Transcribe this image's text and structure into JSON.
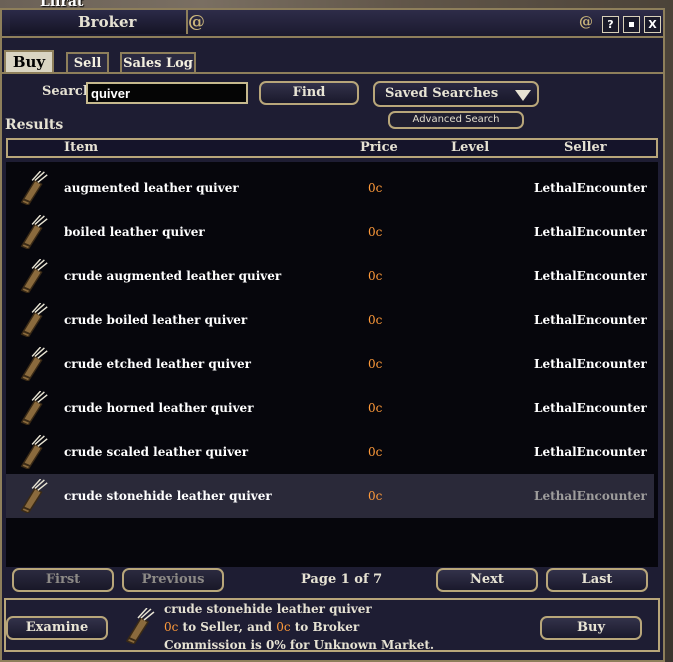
{
  "player_name": "Lilrat",
  "window": {
    "title": "Broker",
    "help": "?",
    "close": "X"
  },
  "tabs": [
    {
      "label": "Buy"
    },
    {
      "label": "Sell"
    },
    {
      "label": "Sales Log"
    }
  ],
  "search": {
    "label": "Search",
    "value": "quiver",
    "find": "Find",
    "saved": "Saved Searches",
    "advanced": "Advanced Search"
  },
  "results_label": "Results",
  "columns": {
    "item": "Item",
    "price": "Price",
    "level": "Level",
    "seller": "Seller"
  },
  "rows": [
    {
      "item": "augmented leather quiver",
      "price": "0c",
      "level": "",
      "seller": "LethalEncounter"
    },
    {
      "item": "boiled leather quiver",
      "price": "0c",
      "level": "",
      "seller": "LethalEncounter"
    },
    {
      "item": "crude augmented leather quiver",
      "price": "0c",
      "level": "",
      "seller": "LethalEncounter"
    },
    {
      "item": "crude boiled leather quiver",
      "price": "0c",
      "level": "",
      "seller": "LethalEncounter"
    },
    {
      "item": "crude etched leather quiver",
      "price": "0c",
      "level": "",
      "seller": "LethalEncounter"
    },
    {
      "item": "crude horned leather quiver",
      "price": "0c",
      "level": "",
      "seller": "LethalEncounter"
    },
    {
      "item": "crude scaled leather quiver",
      "price": "0c",
      "level": "",
      "seller": "LethalEncounter"
    },
    {
      "item": "crude stonehide leather quiver",
      "price": "0c",
      "level": "",
      "seller": "LethalEncounter"
    }
  ],
  "pagination": {
    "first": "First",
    "previous": "Previous",
    "page_text": "Page 1 of 7",
    "next": "Next",
    "last": "Last"
  },
  "selection": {
    "examine": "Examine",
    "item": "crude stonehide leather quiver",
    "seller_price": "0c",
    "to_seller": " to Seller, and ",
    "broker_price": "0c",
    "to_broker": " to Broker",
    "commission": "Commission is 0% for Unknown Market.",
    "buy": "Buy"
  }
}
